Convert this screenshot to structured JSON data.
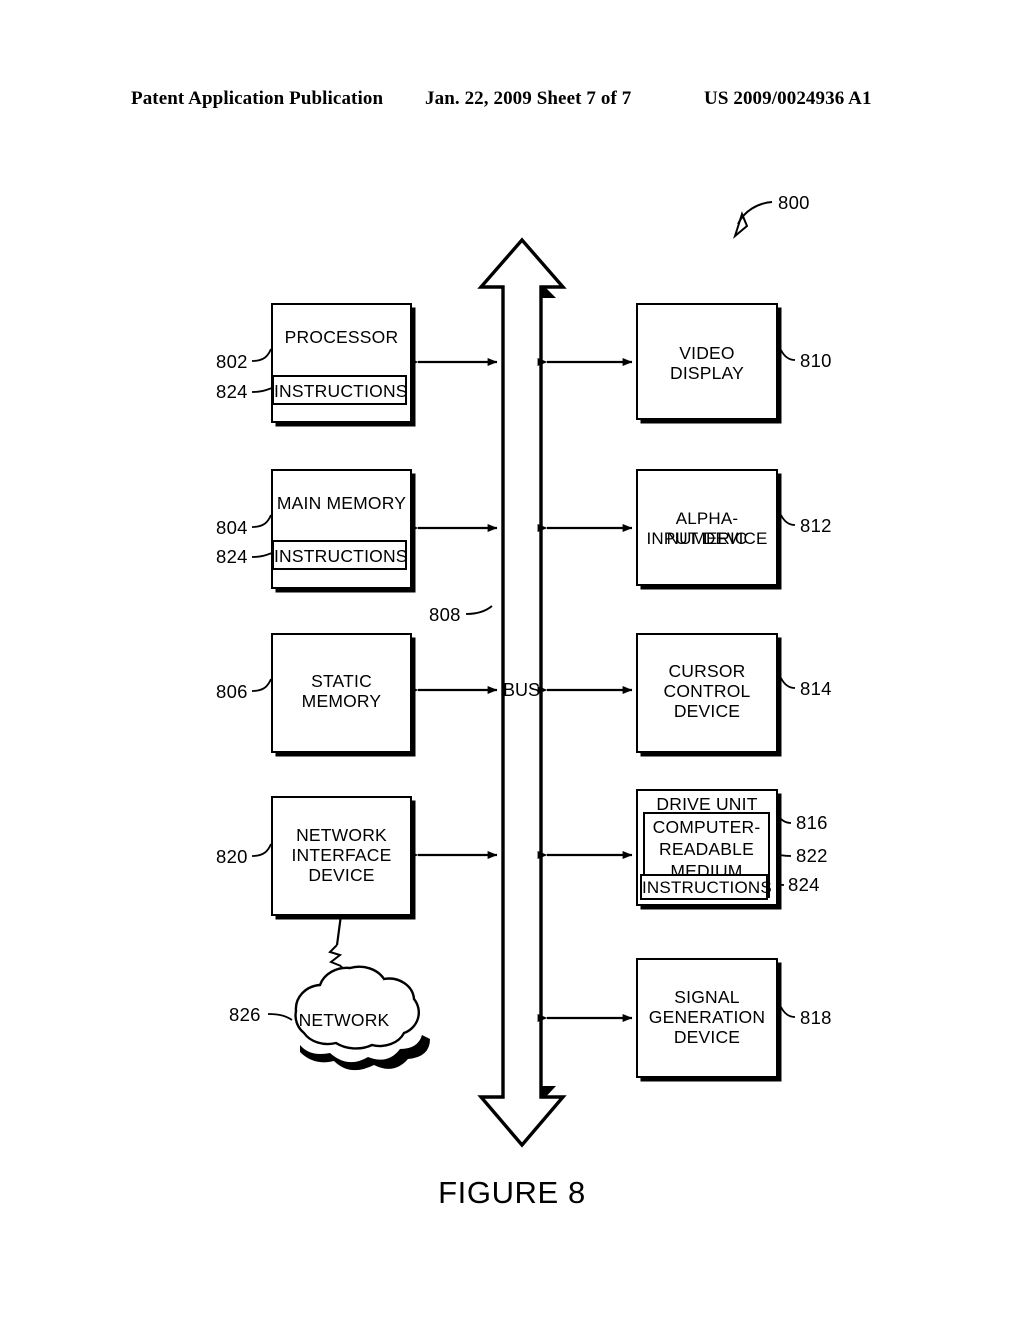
{
  "header": {
    "publication": "Patent Application Publication",
    "date_sheet": "Jan. 22, 2009  Sheet 7 of 7",
    "patent_number": "US 2009/0024936 A1"
  },
  "figure": {
    "caption": "FIGURE 8",
    "system_ref": "800",
    "bus": {
      "label": "BUS",
      "ref": "808"
    }
  },
  "blocks": {
    "processor": {
      "label": "PROCESSOR",
      "ref": "802",
      "inner": {
        "label": "INSTRUCTIONS",
        "ref": "824"
      }
    },
    "main_memory": {
      "label": "MAIN MEMORY",
      "ref": "804",
      "inner": {
        "label": "INSTRUCTIONS",
        "ref": "824"
      }
    },
    "static_memory": {
      "line1": "STATIC",
      "line2": "MEMORY",
      "ref": "806"
    },
    "network_interface": {
      "line1": "NETWORK",
      "line2": "INTERFACE",
      "line3": "DEVICE",
      "ref": "820"
    },
    "network_cloud": {
      "label": "NETWORK",
      "ref": "826"
    },
    "video_display": {
      "line1": "VIDEO",
      "line2": "DISPLAY",
      "ref": "810"
    },
    "alpha_numeric": {
      "line1": "ALPHA-NUMERIC",
      "line2": "INPUT DEVICE",
      "ref": "812"
    },
    "cursor_control": {
      "line1": "CURSOR",
      "line2": "CONTROL",
      "line3": "DEVICE",
      "ref": "814"
    },
    "drive_unit": {
      "label": "DRIVE UNIT",
      "ref": "816",
      "medium": {
        "line1": "COMPUTER-",
        "line2": "READABLE",
        "line3": "MEDIUM",
        "ref": "822"
      },
      "instructions": {
        "label": "INSTRUCTIONS",
        "ref": "824"
      }
    },
    "signal_generation": {
      "line1": "SIGNAL",
      "line2": "GENERATION",
      "line3": "DEVICE",
      "ref": "818"
    }
  },
  "colors": {
    "ink": "#000000",
    "paper": "#ffffff"
  }
}
